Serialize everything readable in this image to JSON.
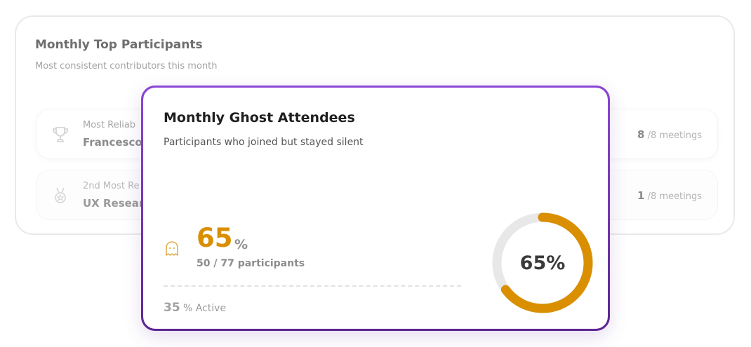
{
  "background_card": {
    "title": "Monthly Top Participants",
    "subtitle": "Most consistent contributors this month",
    "rows": [
      {
        "label": "Most Reliab",
        "name": "Francesco",
        "count": "8",
        "suffix": " /8 meetings",
        "icon": "trophy-icon"
      },
      {
        "label": "2nd Most Re",
        "name": "UX Resear",
        "count": "1",
        "suffix": " /8 meetings",
        "icon": "medal-icon"
      }
    ]
  },
  "ghost_card": {
    "title": "Monthly Ghost Attendees",
    "subtitle": "Participants who joined but stayed silent",
    "icon": "ghost-icon",
    "percent": "65",
    "percent_unit": "%",
    "participants": "50 / 77 participants",
    "active_percent": "35",
    "active_label": "% Active",
    "donut": {
      "value": 65,
      "label": "65%"
    }
  },
  "colors": {
    "accent": "#d98f00",
    "card_border": "#7d3fc0",
    "donut_track": "#e8e8e8"
  }
}
